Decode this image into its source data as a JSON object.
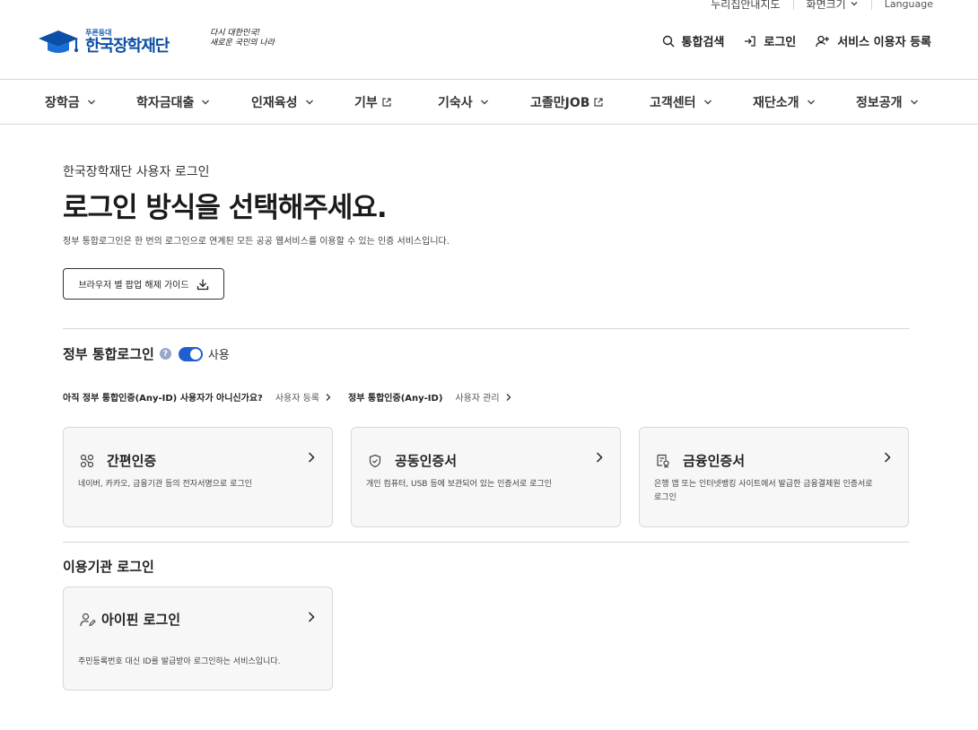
{
  "utility": {
    "items": [
      "누리집안내지도",
      "화면크기",
      "Language"
    ]
  },
  "header": {
    "logo_sub": "푸른등대",
    "logo_main": "한국장학재단",
    "slogan_line1": "다시 대한민국!",
    "slogan_line2": "새로운 국민의 나라",
    "actions": {
      "search": "통합검색",
      "login": "로그인",
      "register": "서비스 이용자 등록"
    }
  },
  "nav": {
    "items": [
      "장학금",
      "학자금대출",
      "인재육성",
      "기부",
      "기숙사",
      "고졸만JOB",
      "고객센터",
      "재단소개",
      "정보공개"
    ]
  },
  "main": {
    "eyebrow": "한국장학재단 사용자 로그인",
    "title": "로그인 방식을 선택해주세요.",
    "description": "정부 통합로그인은 한 번의 로그인으로 연계된 모든 공공 웹서비스를 이용할 수 있는 인증 서비스입니다.",
    "guide_button": "브라우저 별 팝업 해제 가이드"
  },
  "gov_login": {
    "title": "정부 통합로그인",
    "help": "?",
    "toggle_label": "사용",
    "anyid_question": "아직 정부 통합인증(Any-ID) 사용자가 아니신가요?",
    "register_link": "사용자 등록",
    "anyid_label": "정부 통합인증(Any-ID)",
    "manage_link": "사용자 관리",
    "cards": [
      {
        "title": "간편인증",
        "desc": "네이버, 카카오, 금융기관 등의 전자서명으로 로그인"
      },
      {
        "title": "공동인증서",
        "desc": "개인 컴퓨터, USB 등에 보관되어 있는 인증서로 로그인"
      },
      {
        "title": "금융인증서",
        "desc": "은행 앱 또는 인터넷뱅킹 사이트에서 발급한 금융결제원 인증서로 로그인"
      }
    ]
  },
  "org_login": {
    "title": "이용기관 로그인",
    "card": {
      "title": "아이핀 로그인",
      "desc": "주민등록번호 대신 ID를 발급받아 로그인하는 서비스입니다."
    }
  },
  "colors": {
    "brand_blue": "#0d4ea6",
    "toggle_on": "#1f5fd1",
    "card_bg": "#f7f7f7"
  }
}
